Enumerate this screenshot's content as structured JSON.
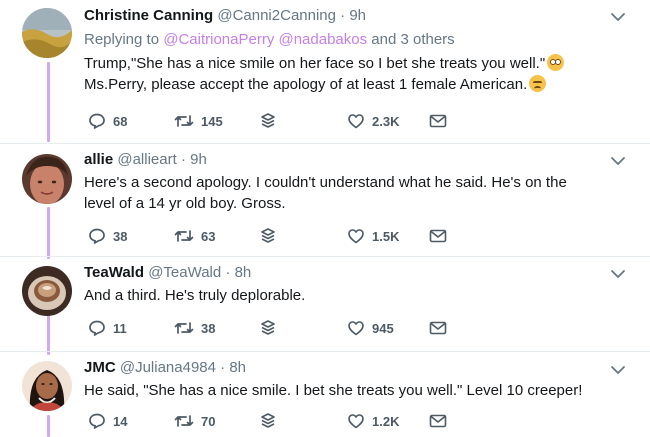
{
  "tweets": [
    {
      "name": "Christine Canning",
      "handle": "@Canni2Canning",
      "dot": "·",
      "time": "9h",
      "reply_prefix": "Replying to",
      "reply_mention_1": "@CaitrionaPerry",
      "reply_mention_2": "@nadabakos",
      "reply_suffix": "and 3 others",
      "text_line_1": "Trump,\"She has a nice smile on her face so I bet she treats you well.\"",
      "text_line_2": "Ms.Perry, please accept the apology of at least 1 female American.",
      "emoji_1": "flushed-face-emoji",
      "emoji_2": "disappointed-face-emoji",
      "replies": "68",
      "retweets": "145",
      "likes": "2.3K"
    },
    {
      "name": "allie",
      "handle": "@allieart",
      "dot": "·",
      "time": "9h",
      "text_line_1": "Here's a second apology. I couldn't understand what he said. He's on the",
      "text_line_2": "level of a 14 yr old boy. Gross.",
      "replies": "38",
      "retweets": "63",
      "likes": "1.5K"
    },
    {
      "name": "TeaWald",
      "handle": "@TeaWald",
      "dot": "·",
      "time": "8h",
      "text_line_1": "And a third. He's truly deplorable.",
      "replies": "11",
      "retweets": "38",
      "likes": "945"
    },
    {
      "name": "JMC",
      "handle": "@Juliana4984",
      "dot": "·",
      "time": "8h",
      "text_line_1": "He said, \"She has a nice smile. I bet she treats you well.\" Level 10 creeper!",
      "replies": "14",
      "retweets": "70",
      "likes": "1.2K"
    }
  ],
  "colors": {
    "thread_line": "#d4a8f0",
    "mention": "#c57fe6",
    "secondary_text": "#657786",
    "icon": "#4d5a66"
  },
  "icons": [
    "reply-icon",
    "retweet-icon",
    "stack-icon",
    "heart-icon",
    "envelope-icon",
    "chevron-down-icon"
  ]
}
